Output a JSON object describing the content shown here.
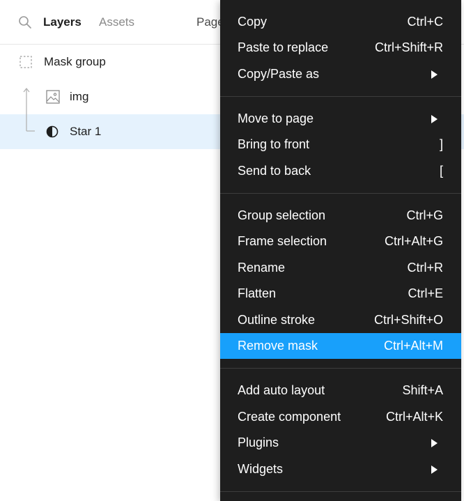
{
  "layers_panel": {
    "tabs": {
      "layers": "Layers",
      "assets": "Assets",
      "page": "Page"
    },
    "rows": [
      {
        "label": "Mask group",
        "icon": "mask-group-icon"
      },
      {
        "label": "img",
        "icon": "image-icon"
      },
      {
        "label": "Star 1",
        "icon": "mask-star-icon",
        "selected": true
      }
    ]
  },
  "context_menu": {
    "copy": {
      "label": "Copy",
      "shortcut": "Ctrl+C"
    },
    "paste_to_replace": {
      "label": "Paste to replace",
      "shortcut": "Ctrl+Shift+R"
    },
    "copy_paste_as": {
      "label": "Copy/Paste as"
    },
    "move_to_page": {
      "label": "Move to page"
    },
    "bring_to_front": {
      "label": "Bring to front",
      "shortcut": "]"
    },
    "send_to_back": {
      "label": "Send to back",
      "shortcut": "["
    },
    "group_selection": {
      "label": "Group selection",
      "shortcut": "Ctrl+G"
    },
    "frame_selection": {
      "label": "Frame selection",
      "shortcut": "Ctrl+Alt+G"
    },
    "rename": {
      "label": "Rename",
      "shortcut": "Ctrl+R"
    },
    "flatten": {
      "label": "Flatten",
      "shortcut": "Ctrl+E"
    },
    "outline_stroke": {
      "label": "Outline stroke",
      "shortcut": "Ctrl+Shift+O"
    },
    "remove_mask": {
      "label": "Remove mask",
      "shortcut": "Ctrl+Alt+M",
      "highlighted": true
    },
    "add_auto_layout": {
      "label": "Add auto layout",
      "shortcut": "Shift+A"
    },
    "create_component": {
      "label": "Create component",
      "shortcut": "Ctrl+Alt+K"
    },
    "plugins": {
      "label": "Plugins"
    },
    "widgets": {
      "label": "Widgets"
    }
  },
  "colors": {
    "menu_bg": "#1e1e1e",
    "highlight": "#18a0fb",
    "selected_row": "#e5f2fd"
  }
}
